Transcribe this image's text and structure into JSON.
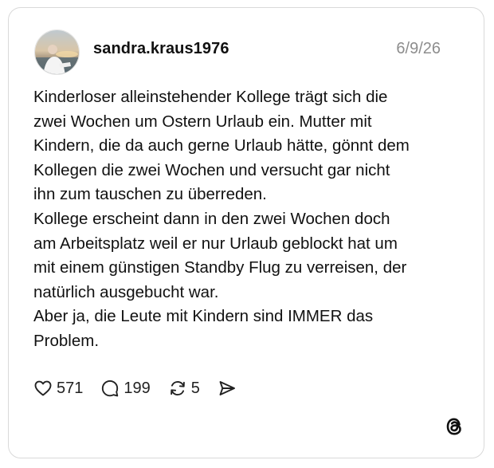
{
  "post": {
    "username": "sandra.kraus1976",
    "date": "6/9/26",
    "lines": [
      "Kinderloser alleinstehender Kollege trägt sich die",
      "zwei Wochen um Ostern Urlaub ein. Mutter mit",
      "Kindern, die da auch gerne Urlaub hätte, gönnt dem",
      "Kollegen die zwei Wochen und versucht gar nicht",
      "ihn zum tauschen zu überreden.",
      "Kollege erscheint dann in den zwei Wochen doch",
      "am Arbeitsplatz weil er nur Urlaub geblockt hat um",
      "mit einem günstigen Standby Flug zu verreisen, der",
      "natürlich ausgebucht war.",
      "Aber ja, die Leute mit Kindern sind IMMER das",
      "Problem."
    ]
  },
  "actions": {
    "likes": "571",
    "replies": "199",
    "reposts": "5"
  },
  "icons": {
    "like": "heart-icon",
    "reply": "speech-bubble-icon",
    "repost": "repost-arrows-icon",
    "share": "send-icon",
    "brand": "threads-logo-icon"
  },
  "colors": {
    "text": "#111111",
    "muted": "#8d8d8d",
    "border": "#d9d9d9"
  }
}
